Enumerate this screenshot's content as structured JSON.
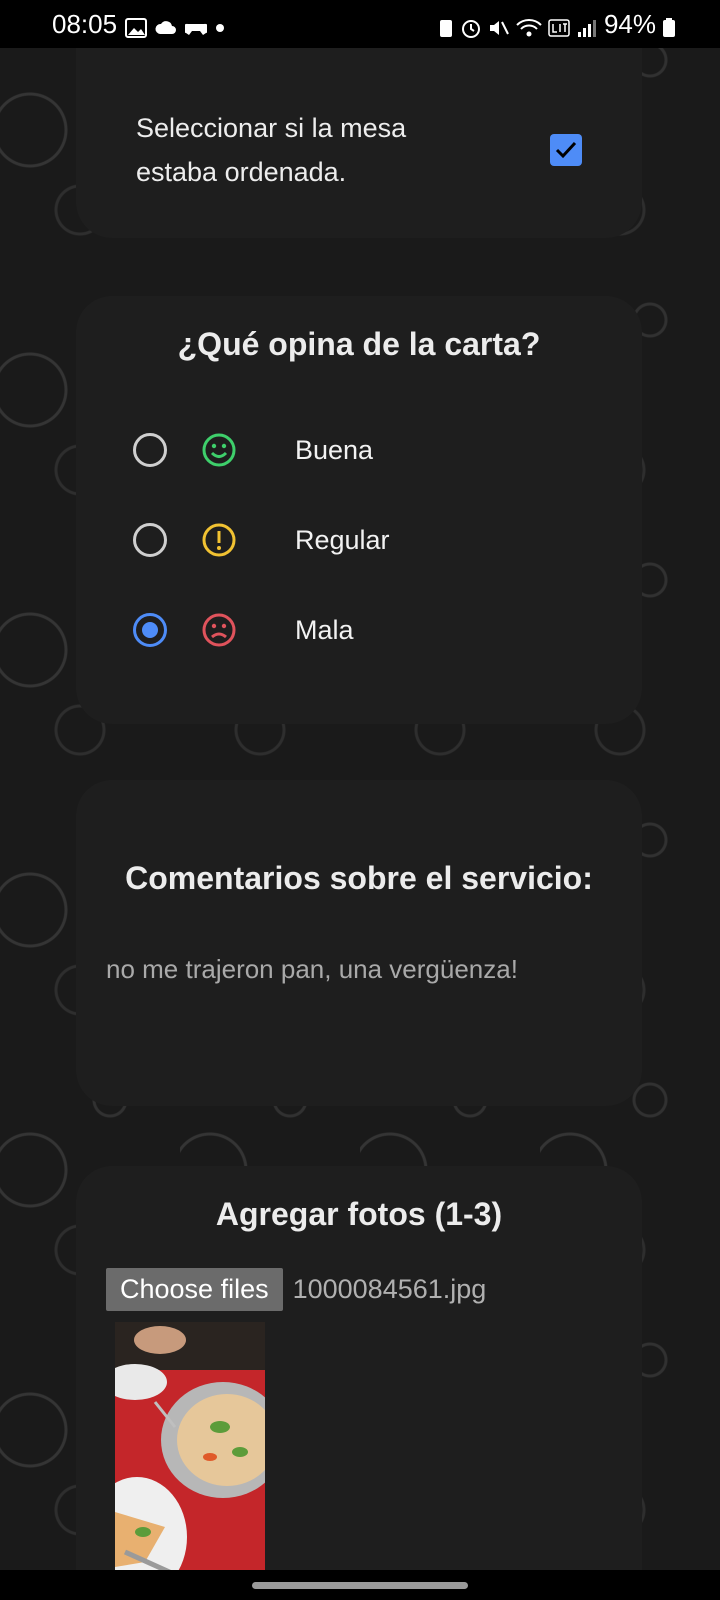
{
  "status_bar": {
    "time": "08:05",
    "battery": "94%"
  },
  "mesa_card": {
    "question_text": "Seleccionar si la mesa estaba ordenada.",
    "checked": true
  },
  "carta_card": {
    "title": "¿Qué opina de la carta?",
    "options": [
      {
        "label": "Buena",
        "icon": "smile-icon",
        "color": "#3ecf6b",
        "selected": false
      },
      {
        "label": "Regular",
        "icon": "warning-icon",
        "color": "#f1c232",
        "selected": false
      },
      {
        "label": "Mala",
        "icon": "frown-icon",
        "color": "#e0535c",
        "selected": true
      }
    ]
  },
  "comentarios_card": {
    "title": "Comentarios sobre el servicio:",
    "value": "no me trajeron pan, una vergüenza!"
  },
  "fotos_card": {
    "title": "Agregar fotos (1-3)",
    "choose_label": "Choose files",
    "file_name": "1000084561.jpg"
  },
  "colors": {
    "accent": "#4e8cf7",
    "card_bg": "#1e1e1e",
    "page_bg": "#1a1a1a"
  }
}
